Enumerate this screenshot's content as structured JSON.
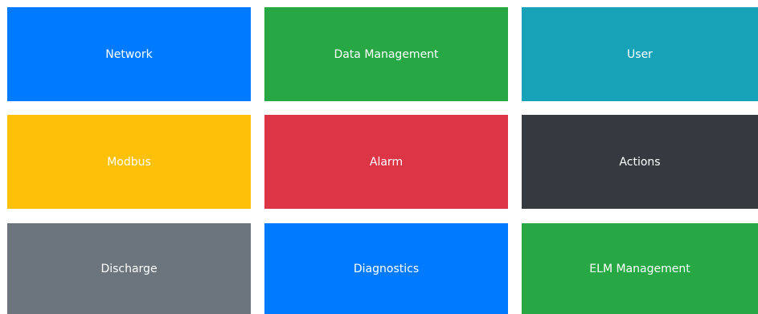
{
  "tiles": [
    {
      "label": "Network",
      "color": "#007bff"
    },
    {
      "label": "Data Management",
      "color": "#28a745"
    },
    {
      "label": "User",
      "color": "#17a2b8"
    },
    {
      "label": "Modbus",
      "color": "#ffc107"
    },
    {
      "label": "Alarm",
      "color": "#dc3545"
    },
    {
      "label": "Actions",
      "color": "#343a40"
    },
    {
      "label": "Discharge",
      "color": "#6c757d"
    },
    {
      "label": "Diagnostics",
      "color": "#007bff"
    },
    {
      "label": "ELM Management",
      "color": "#28a745"
    }
  ]
}
